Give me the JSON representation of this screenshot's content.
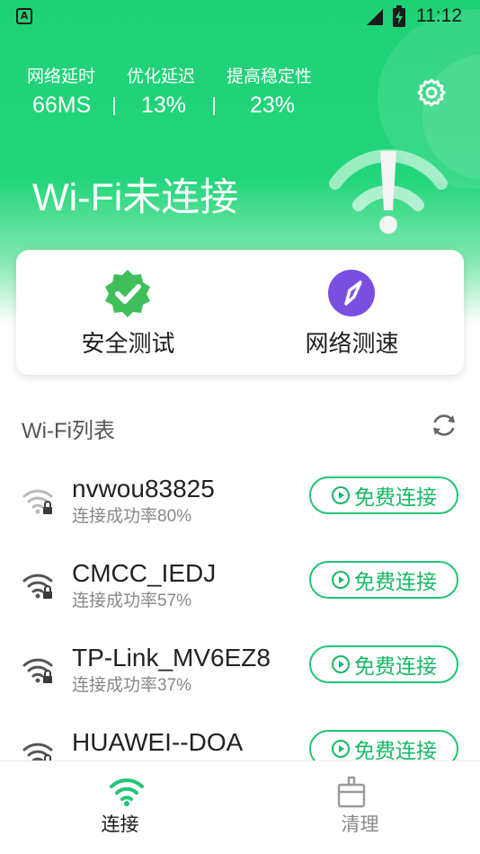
{
  "status_bar": {
    "time": "11:12",
    "app_badge": "A",
    "icons": [
      "app-notification-icon",
      "cell-signal-icon",
      "battery-charging-icon"
    ]
  },
  "stats": {
    "labels": [
      "网络延时",
      "优化延迟",
      "提高稳定性"
    ],
    "values": [
      "66MS",
      "13%",
      "23%"
    ]
  },
  "settings_icon": "gear-icon",
  "wifi_status": "Wi-Fi未连接",
  "tools": [
    {
      "label": "安全测试",
      "icon": "shield-check-icon",
      "color": "#3ebf5a"
    },
    {
      "label": "网络测速",
      "icon": "compass-icon",
      "color": "#7a4fe0"
    }
  ],
  "wifi_list": {
    "title": "Wi-Fi列表",
    "refresh_icon": "refresh-icon",
    "networks": [
      {
        "ssid": "nvwou83825",
        "rate": "连接成功率80%",
        "button": "免费连接"
      },
      {
        "ssid": "CMCC_IEDJ",
        "rate": "连接成功率57%",
        "button": "免费连接"
      },
      {
        "ssid": "TP-Link_MV6EZ8",
        "rate": "连接成功率37%",
        "button": "免费连接"
      },
      {
        "ssid": "HUAWEI--DOA",
        "rate": "",
        "button": "免费连接"
      }
    ]
  },
  "bottom_nav": [
    {
      "label": "连接",
      "icon": "wifi-icon",
      "active": true
    },
    {
      "label": "清理",
      "icon": "broom-icon",
      "active": false
    }
  ],
  "colors": {
    "brand_green": "#22d57a",
    "accent_green": "#18b866",
    "nav_inactive": "#8a8a8a"
  }
}
